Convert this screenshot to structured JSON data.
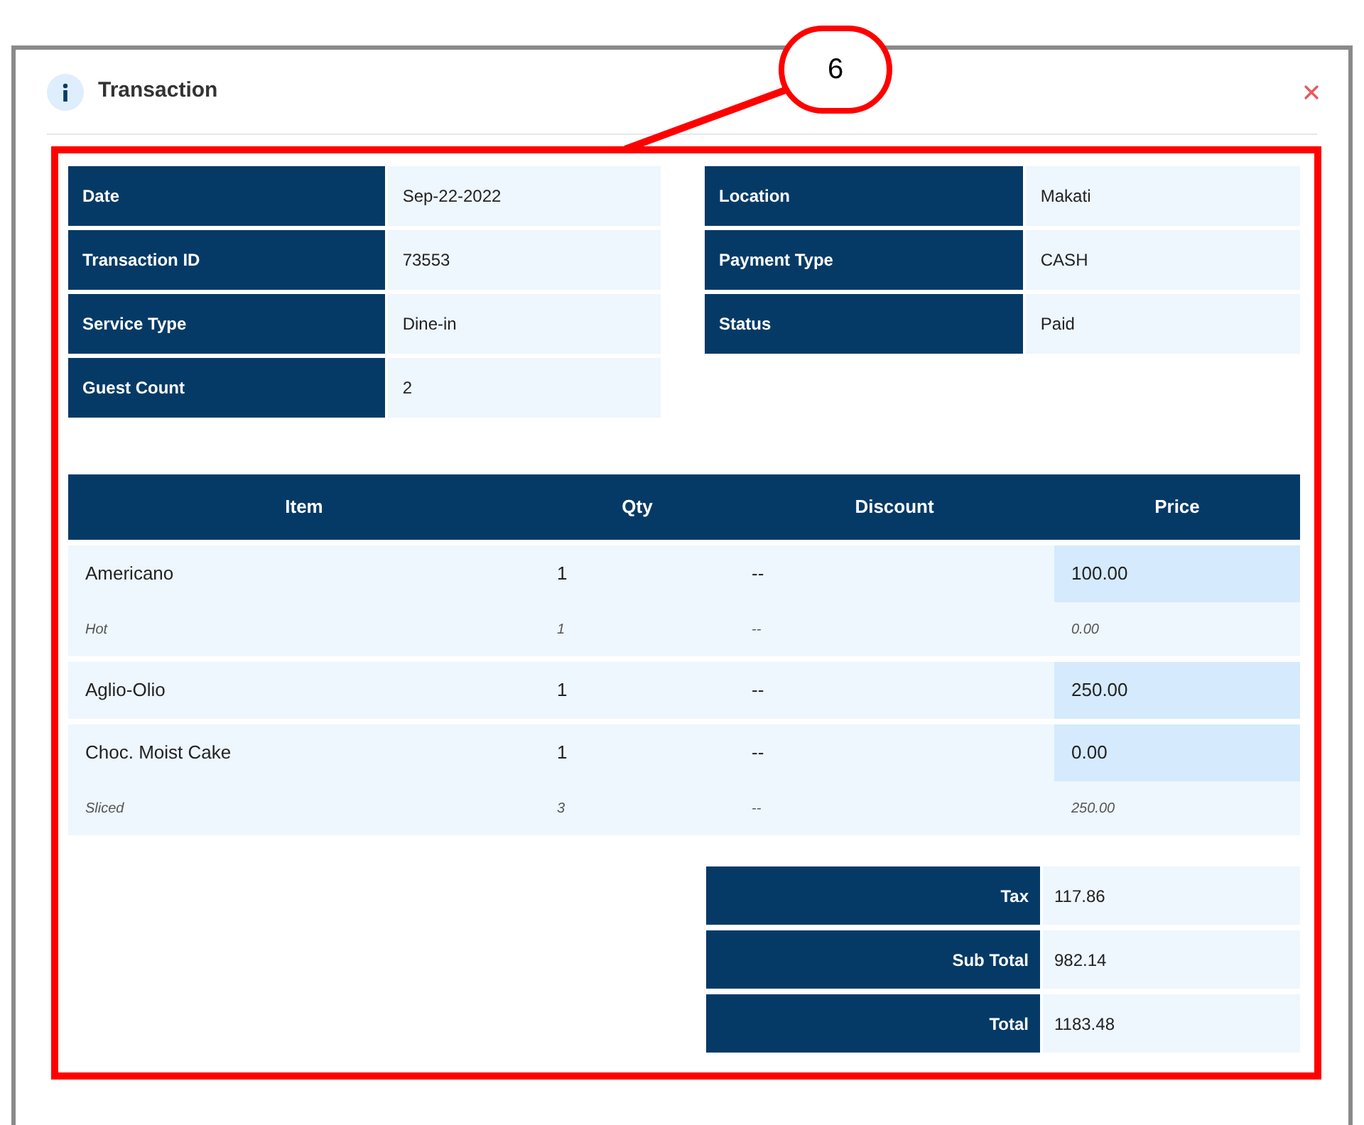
{
  "dialog": {
    "title": "Transaction"
  },
  "annotation": {
    "label": "6"
  },
  "details_left": [
    {
      "label": "Date",
      "value": "Sep-22-2022"
    },
    {
      "label": "Transaction ID",
      "value": "73553"
    },
    {
      "label": "Service Type",
      "value": "Dine-in"
    },
    {
      "label": "Guest Count",
      "value": "2"
    }
  ],
  "details_right": [
    {
      "label": "Location",
      "value": "Makati"
    },
    {
      "label": "Payment Type",
      "value": "CASH"
    },
    {
      "label": "Status",
      "value": "Paid"
    }
  ],
  "table": {
    "columns": [
      "Item",
      "Qty",
      "Discount",
      "Price"
    ],
    "rows": [
      {
        "item": "Americano",
        "qty": "1",
        "discount": "--",
        "price": "100.00",
        "modifiers": [
          {
            "item": "Hot",
            "qty": "1",
            "discount": "--",
            "price": "0.00"
          }
        ]
      },
      {
        "item": "Aglio-Olio",
        "qty": "1",
        "discount": "--",
        "price": "250.00",
        "modifiers": []
      },
      {
        "item": "Choc. Moist Cake",
        "qty": "1",
        "discount": "--",
        "price": "0.00",
        "modifiers": [
          {
            "item": "Sliced",
            "qty": "3",
            "discount": "--",
            "price": "250.00"
          }
        ]
      }
    ]
  },
  "totals": [
    {
      "label": "Tax",
      "value": "117.86"
    },
    {
      "label": "Sub Total",
      "value": "982.14"
    },
    {
      "label": "Total",
      "value": "1183.48"
    }
  ]
}
